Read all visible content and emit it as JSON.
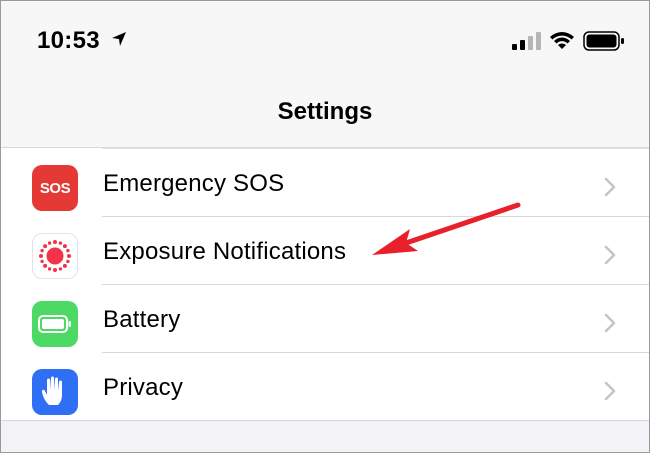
{
  "status_bar": {
    "time": "10:53",
    "icons": [
      "location-arrow-icon",
      "cellular-signal-icon",
      "wifi-icon",
      "battery-icon"
    ]
  },
  "nav": {
    "title": "Settings"
  },
  "rows": [
    {
      "label": "Emergency SOS",
      "icon": "sos-icon",
      "icon_text": "SOS",
      "icon_color": "#e53935"
    },
    {
      "label": "Exposure Notifications",
      "icon": "exposure-notifications-icon",
      "icon_color": "#ffffff"
    },
    {
      "label": "Battery",
      "icon": "battery-icon",
      "icon_color": "#4cd964"
    },
    {
      "label": "Privacy",
      "icon": "hand-icon",
      "icon_color": "#2f6ff5"
    }
  ],
  "annotation": {
    "icon": "red-arrow-icon",
    "color": "#e8202a",
    "points_to": "Exposure Notifications"
  }
}
